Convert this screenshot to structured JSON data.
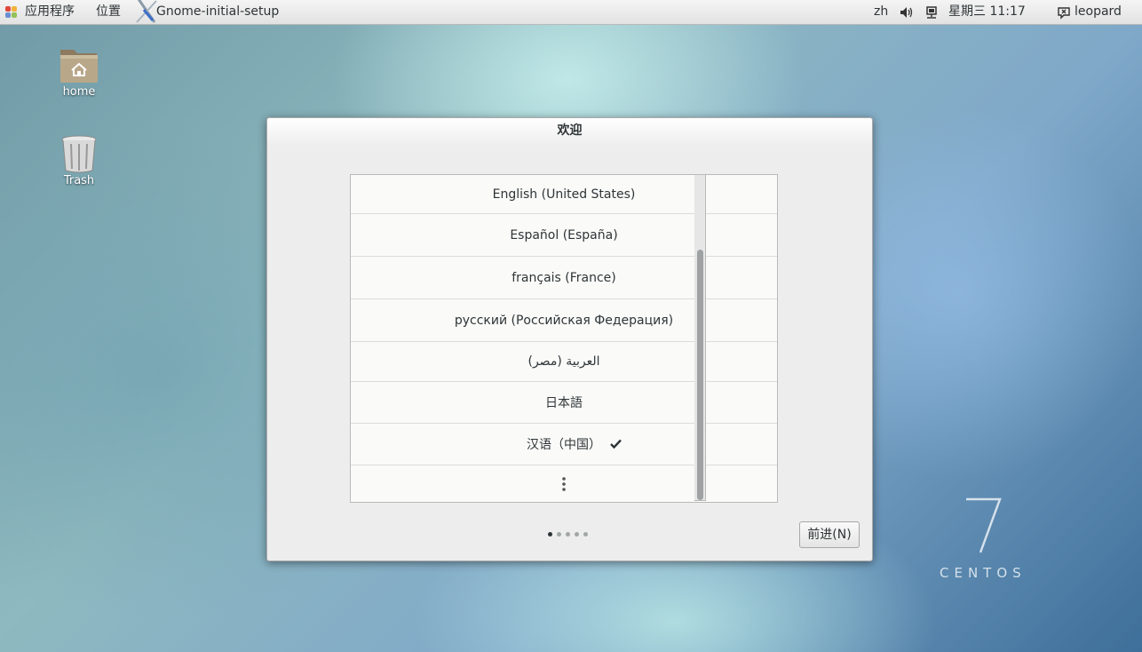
{
  "top_panel": {
    "applications_label": "应用程序",
    "places_label": "位置",
    "window_title": "Gnome-initial-setup",
    "keyboard_layout": "zh",
    "clock": "星期三 11:17",
    "user_name": "leopard"
  },
  "desktop": {
    "icons": [
      {
        "label": "home",
        "icon": "home-folder-icon"
      },
      {
        "label": "Trash",
        "icon": "trash-icon"
      }
    ]
  },
  "dialog": {
    "title": "欢迎",
    "languages": [
      {
        "label": "English (United States)",
        "selected": false
      },
      {
        "label": "Español (España)",
        "selected": false
      },
      {
        "label": "français (France)",
        "selected": false
      },
      {
        "label": "русский (Российская Федерация)",
        "selected": false
      },
      {
        "label": "العربية (مصر)",
        "selected": false
      },
      {
        "label": "日本語",
        "selected": false
      },
      {
        "label": "汉语（中国）",
        "selected": true
      }
    ],
    "more_icon": "vertical-ellipsis-icon",
    "check_icon": "checkmark-icon",
    "page_dots": {
      "total": 5,
      "current": 1
    },
    "next_button": "前进(N)"
  },
  "branding": {
    "number": "7",
    "name": "CENTOS"
  },
  "colors": {
    "panel_bg": "#e9e9e9",
    "dialog_bg": "#ededed",
    "list_bg": "#fafaf9",
    "text": "#2e3436"
  }
}
